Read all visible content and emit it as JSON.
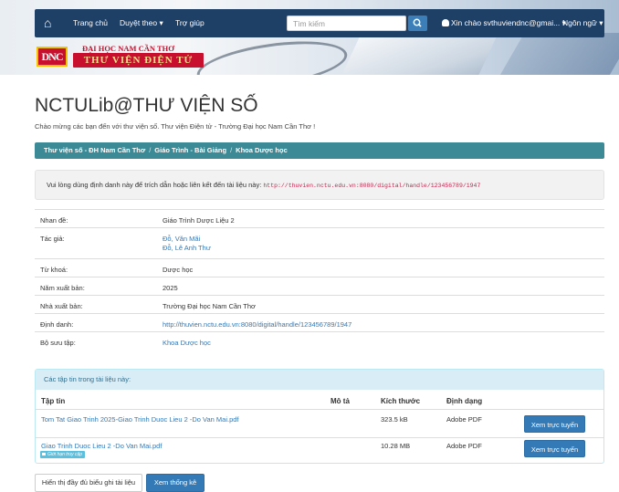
{
  "nav": {
    "home": "Trang chủ",
    "browse": "Duyệt theo",
    "help": "Trợ giúp",
    "search_placeholder": "Tìm kiếm",
    "user": "Xin chào svthuviendnc@gmai...",
    "language": "Ngôn ngữ"
  },
  "logo": {
    "mark": "DNC",
    "top": "ĐẠI HỌC NAM CẦN THƠ",
    "bottom": "THƯ VIỆN ĐIỆN TỬ"
  },
  "header": {
    "title": "NCTULib@THƯ VIỆN SỐ",
    "subtitle": "Chào mừng các bạn đến với thư viện số. Thư viện Điện tử - Trường Đại học Nam Cần Thơ !"
  },
  "breadcrumb": [
    "Thư viện số - ĐH Nam Cần Thơ",
    "Giáo Trình - Bài Giảng",
    "Khoa Dược học"
  ],
  "cite": {
    "text": "Vui lòng dùng định danh này để trích dẫn hoặc liên kết đến tài liệu này:",
    "url": "http://thuvien.nctu.edu.vn:8080/digital/handle/123456789/1947"
  },
  "metadata": {
    "title_label": "Nhan đề:",
    "title_value": "Giáo Trình Dược Liệu 2",
    "authors_label": "Tác giả:",
    "authors": [
      "Đỗ, Văn Mãi",
      "Đỗ, Lê Anh Thư"
    ],
    "keywords_label": "Từ khoá:",
    "keywords_value": "Dược học",
    "year_label": "Năm xuất bản:",
    "year_value": "2025",
    "publisher_label": "Nhà xuất bản:",
    "publisher_value": "Trường Đại học Nam Cần Thơ",
    "uri_label": "Định danh:",
    "uri_value": "http://thuvien.nctu.edu.vn:8080/digital/handle/123456789/1947",
    "collection_label": "Bộ sưu tập:",
    "collection_value": "Khoa Dược học"
  },
  "files": {
    "heading": "Các tập tin trong tài liệu này:",
    "columns": {
      "file": "Tập tin",
      "desc": "Mô tả",
      "size": "Kích thước",
      "format": "Định dạng"
    },
    "rows": [
      {
        "name": "Tom Tat Giao Trinh 2025-Giao Trinh Duoc Lieu 2 -Do Van Mai.pdf",
        "size": "323.5 kB",
        "format": "Adobe PDF",
        "action": "Xem trực tuyến"
      },
      {
        "name": "Giao Trinh Duoc Lieu 2 -Do Van Mai.pdf",
        "size": "10.28 MB",
        "format": "Adobe PDF",
        "action": "Xem trực tuyến",
        "badge": "Giới hạn truy cập"
      }
    ]
  },
  "buttons": {
    "full_record": "Hiển thị đầy đủ biểu ghi tài liệu",
    "stats": "Xem thống kê"
  }
}
